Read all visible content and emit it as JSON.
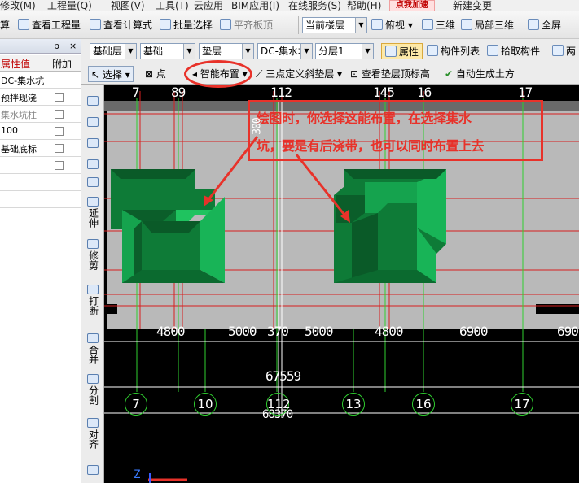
{
  "menu": [
    "修改(M)",
    "工程量(Q)",
    "视图(V)",
    "工具(T)",
    "云应用",
    "BIM应用(I)",
    "在线服务(S)",
    "帮助(H)",
    "新建变更"
  ],
  "promo_label": "点我加速",
  "toolbar1": {
    "suan": "算",
    "view_quantity": "查看工程量",
    "view_formula": "查看计算式",
    "batch_select": "批量选择",
    "flat_roof": "平齐板顶",
    "floor_combo": "当前楼层",
    "view_mode": "俯视",
    "three_d": "三维",
    "partial_3d": "局部三维",
    "full_screen": "全屏"
  },
  "panel": {
    "pin": "ᵽ",
    "close": "×",
    "header_prop": "属性值",
    "header_add": "附加",
    "rows": [
      "DC-集水坑",
      "预拌现浇",
      "集水坑柱",
      "100",
      "基础底标",
      "",
      "",
      ""
    ]
  },
  "toolbar2": {
    "layer1": "基础层",
    "category": "基础",
    "type": "垫层",
    "component": "DC-集水坑",
    "sublayer": "分层1",
    "properties": "属性",
    "component_list": "构件列表",
    "pick_component": "拾取构件",
    "two_point": "两"
  },
  "toolbar3": {
    "select": "选择",
    "point": "点",
    "smart_layout": "智能布置",
    "three_point_slope": "三点定义斜垫层",
    "view_top_elevation": "查看垫层顶标高",
    "auto_earthwork": "自动生成土方"
  },
  "vtools": [
    "延伸",
    "修剪",
    "打断",
    "合并",
    "分割",
    "对齐"
  ],
  "canvas": {
    "top_axes": [
      "7",
      "89",
      "112",
      "145",
      "16",
      "17"
    ],
    "dims_row": [
      "4800",
      "5000",
      "370",
      "5000",
      "4800",
      "6900",
      "690"
    ],
    "total_dim_1": "67559",
    "total_dim_2": "68370",
    "bottom_axes": [
      "7",
      "10",
      "112",
      "13",
      "16",
      "17"
    ],
    "left_dim": "300",
    "axis_z": "Z"
  },
  "callout": {
    "line1": "绘图时，你选择这能布置，在选择集水",
    "line2": "坑，要是有后浇带，也可以同时布置上去"
  },
  "colors": {
    "accent_red": "#e8322a",
    "pit_green": "#13a04c",
    "axis_green": "#2fcf2f"
  }
}
